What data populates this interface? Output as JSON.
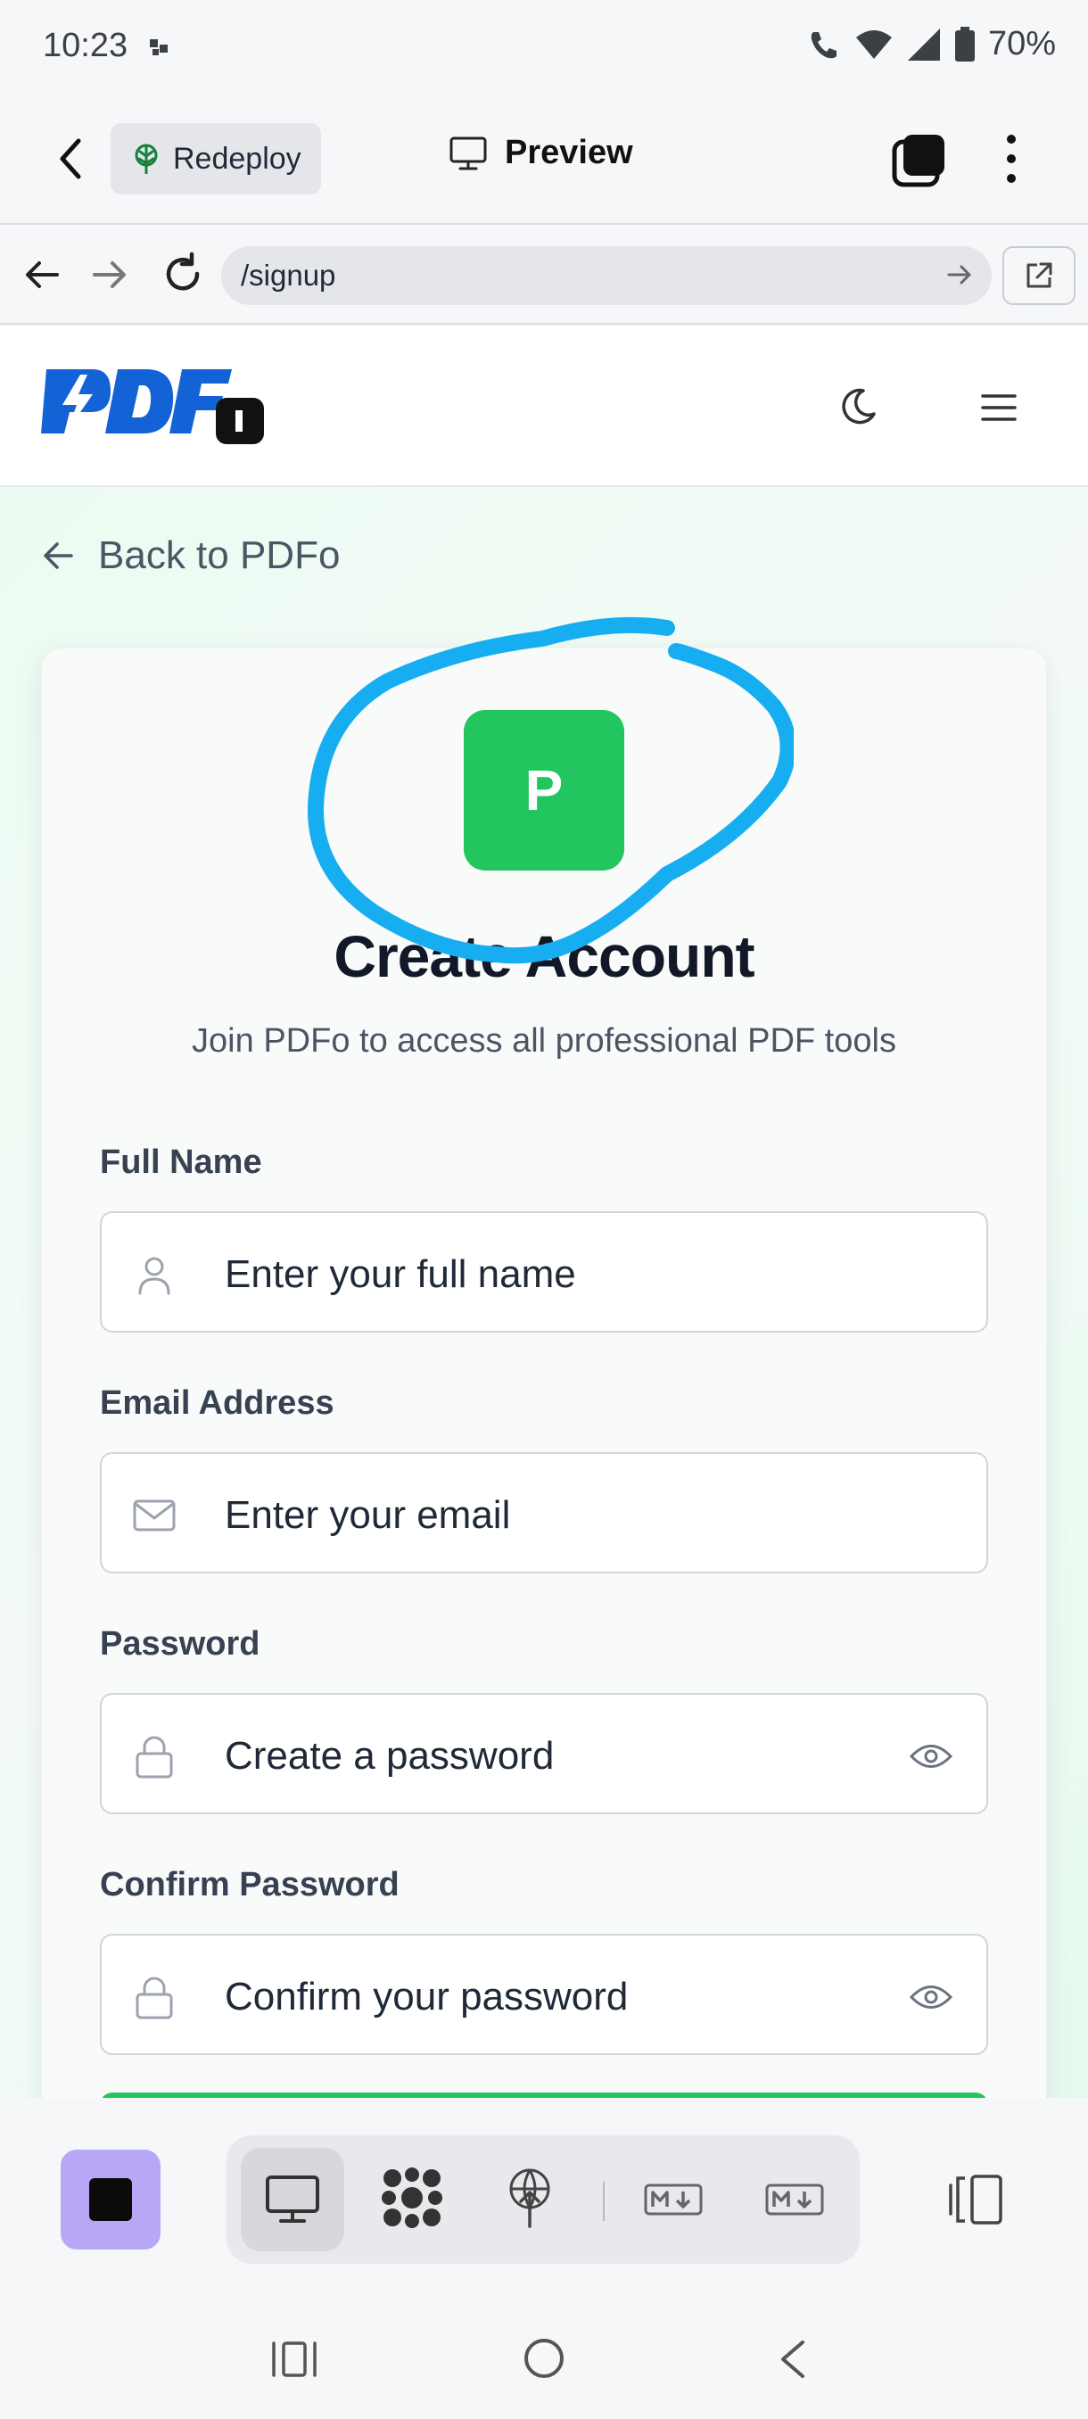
{
  "status_bar": {
    "time": "10:23",
    "battery": "70%"
  },
  "app_bar": {
    "redeploy_label": "Redeploy",
    "preview_label": "Preview"
  },
  "url_bar": {
    "url": "/signup"
  },
  "site": {
    "logo_text": "PDFo"
  },
  "page": {
    "back_link": "Back to PDFo",
    "badge_letter": "P",
    "title": "Create Account",
    "subtitle": "Join PDFo to access all professional PDF tools"
  },
  "form": {
    "full_name": {
      "label": "Full Name",
      "placeholder": "Enter your full name"
    },
    "email": {
      "label": "Email Address",
      "placeholder": "Enter your email"
    },
    "password": {
      "label": "Password",
      "placeholder": "Create a password"
    },
    "confirm_password": {
      "label": "Confirm Password",
      "placeholder": "Confirm your password"
    }
  },
  "colors": {
    "accent_green": "#22c55e",
    "logo_blue": "#1463d6",
    "annotation_blue": "#16aef0",
    "toolbar_purple": "#b8a7f7"
  }
}
